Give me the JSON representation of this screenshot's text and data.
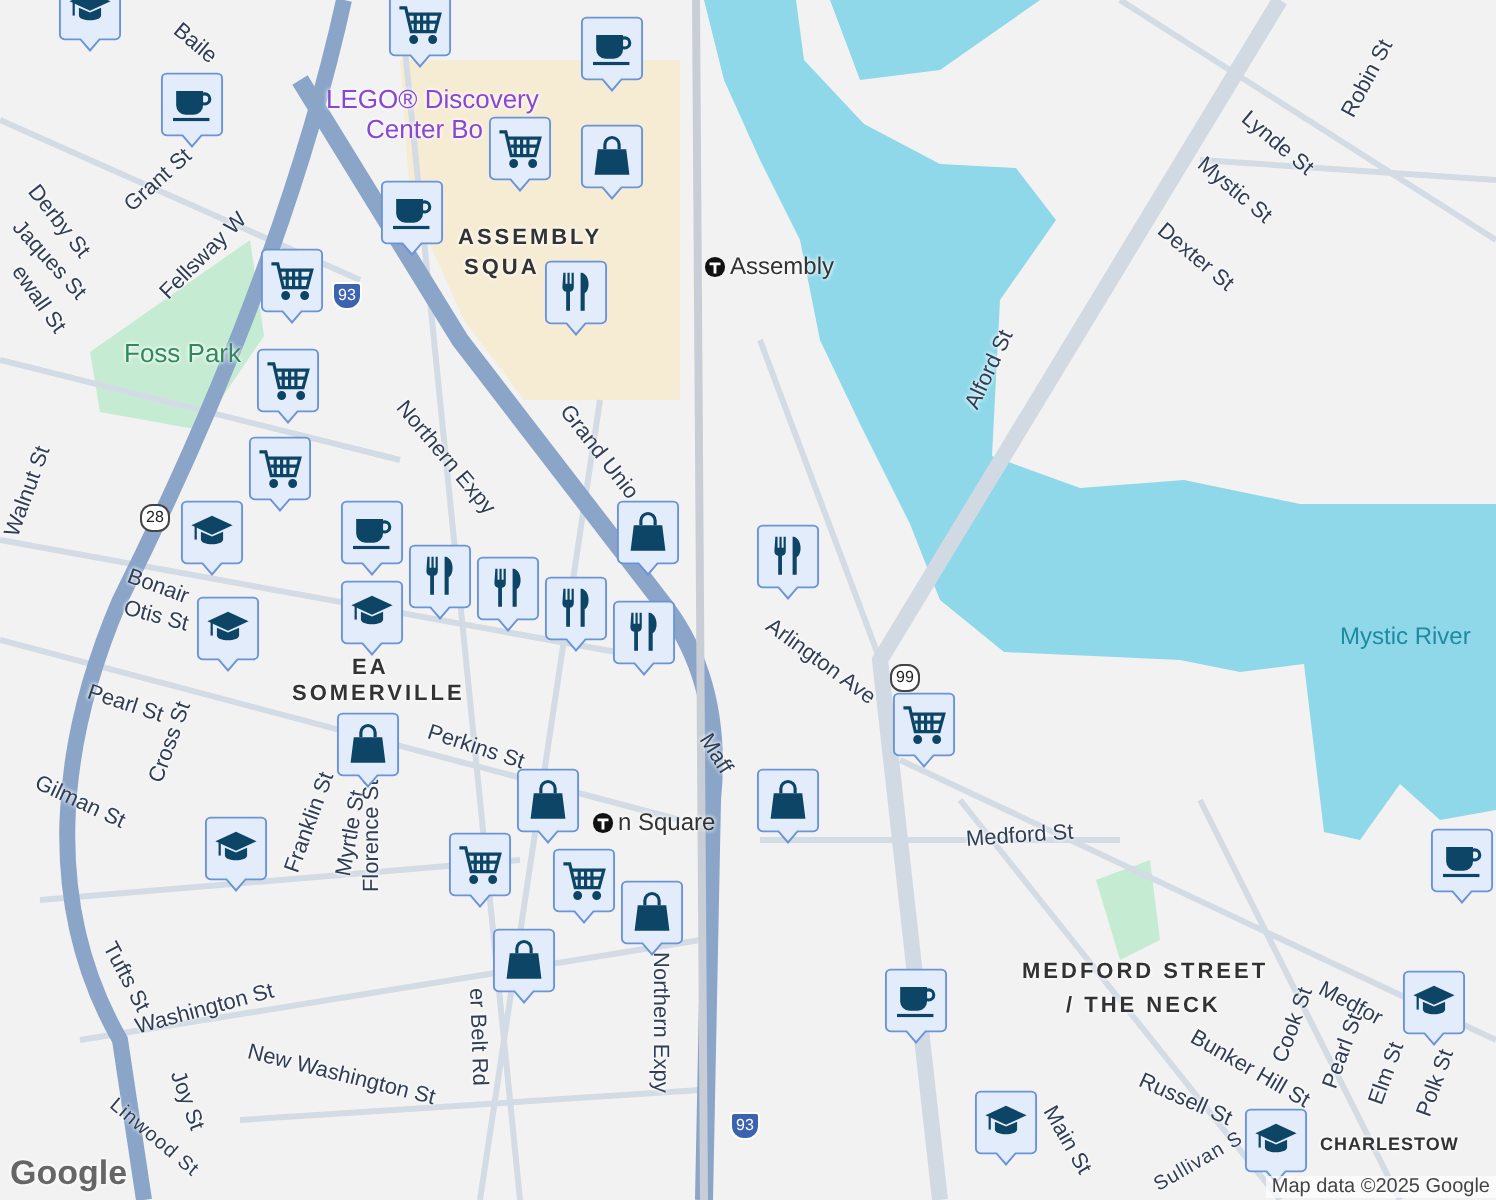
{
  "map": {
    "labels": [
      {
        "text": "Baile",
        "kind": "street"
      },
      {
        "text": "Derby St",
        "kind": "street"
      },
      {
        "text": "Grant St",
        "kind": "street"
      },
      {
        "text": "Jaques St",
        "kind": "street"
      },
      {
        "text": "ewall St",
        "kind": "street"
      },
      {
        "text": "Fellsway W",
        "kind": "street"
      },
      {
        "text": "Foss Park",
        "kind": "park"
      },
      {
        "text": "LEGO® Discovery",
        "kind": "poi"
      },
      {
        "text": "Center Bo",
        "kind": "poi"
      },
      {
        "text": "ASSEMBLY",
        "kind": "district"
      },
      {
        "text": "SQUA",
        "kind": "district"
      },
      {
        "text": "Assembly",
        "kind": "transit"
      },
      {
        "text": "Grand Unio",
        "kind": "street"
      },
      {
        "text": "Northern Expy",
        "kind": "street"
      },
      {
        "text": "Walnut St",
        "kind": "street"
      },
      {
        "text": "Bonair",
        "kind": "street"
      },
      {
        "text": "Otis St",
        "kind": "street"
      },
      {
        "text": "Pearl St",
        "kind": "street"
      },
      {
        "text": "Cross St",
        "kind": "street"
      },
      {
        "text": "Gilman St",
        "kind": "street"
      },
      {
        "text": "EA",
        "kind": "district"
      },
      {
        "text": "SOMERVILLE",
        "kind": "district"
      },
      {
        "text": "Perkins St",
        "kind": "street"
      },
      {
        "text": "Franklin St",
        "kind": "street"
      },
      {
        "text": "Myrtle St",
        "kind": "street"
      },
      {
        "text": "Florence St",
        "kind": "street"
      },
      {
        "text": "n Square",
        "kind": "transit"
      },
      {
        "text": "Tufts St",
        "kind": "street"
      },
      {
        "text": "Washington St",
        "kind": "street"
      },
      {
        "text": "New Washington St",
        "kind": "street"
      },
      {
        "text": "Joy St",
        "kind": "street"
      },
      {
        "text": "Linwood St",
        "kind": "street"
      },
      {
        "text": "er Belt Rd",
        "kind": "street"
      },
      {
        "text": "Northern Expy",
        "kind": "street"
      },
      {
        "text": "Alford St",
        "kind": "street"
      },
      {
        "text": "Lynde St",
        "kind": "street"
      },
      {
        "text": "Mystic St",
        "kind": "street"
      },
      {
        "text": "Dexter St",
        "kind": "street"
      },
      {
        "text": "Robin St",
        "kind": "street"
      },
      {
        "text": "Mystic River",
        "kind": "water"
      },
      {
        "text": "Arlington Ave",
        "kind": "street"
      },
      {
        "text": "Medford St",
        "kind": "street"
      },
      {
        "text": "MEDFORD STREET",
        "kind": "district"
      },
      {
        "text": "/ THE NECK",
        "kind": "district"
      },
      {
        "text": "Medfor",
        "kind": "street"
      },
      {
        "text": "Bunker Hill St",
        "kind": "street"
      },
      {
        "text": "Russell St",
        "kind": "street"
      },
      {
        "text": "Cook St",
        "kind": "street"
      },
      {
        "text": "Pearl St",
        "kind": "street"
      },
      {
        "text": "Elm St",
        "kind": "street"
      },
      {
        "text": "Polk St",
        "kind": "street"
      },
      {
        "text": "Main St",
        "kind": "street"
      },
      {
        "text": "CHARLESTOW",
        "kind": "district"
      },
      {
        "text": "Sullivan S",
        "kind": "street"
      },
      {
        "text": "Maff",
        "kind": "street"
      }
    ],
    "shields": [
      {
        "text": "28",
        "kind": "state"
      },
      {
        "text": "99",
        "kind": "state"
      },
      {
        "text": "93",
        "kind": "interstate"
      },
      {
        "text": "93",
        "kind": "interstate"
      }
    ],
    "pins": [
      {
        "kind": "school"
      },
      {
        "kind": "cart"
      },
      {
        "kind": "cafe"
      },
      {
        "kind": "cafe"
      },
      {
        "kind": "cart"
      },
      {
        "kind": "bag"
      },
      {
        "kind": "cafe"
      },
      {
        "kind": "restaurant"
      },
      {
        "kind": "cart"
      },
      {
        "kind": "cart"
      },
      {
        "kind": "cart"
      },
      {
        "kind": "school"
      },
      {
        "kind": "bag"
      },
      {
        "kind": "cafe"
      },
      {
        "kind": "restaurant"
      },
      {
        "kind": "restaurant"
      },
      {
        "kind": "restaurant"
      },
      {
        "kind": "restaurant"
      },
      {
        "kind": "restaurant"
      },
      {
        "kind": "school"
      },
      {
        "kind": "school"
      },
      {
        "kind": "bag"
      },
      {
        "kind": "school"
      },
      {
        "kind": "bag"
      },
      {
        "kind": "cart"
      },
      {
        "kind": "cart"
      },
      {
        "kind": "bag"
      },
      {
        "kind": "bag"
      },
      {
        "kind": "bag"
      },
      {
        "kind": "cart"
      },
      {
        "kind": "cafe"
      },
      {
        "kind": "school"
      },
      {
        "kind": "school"
      },
      {
        "kind": "school"
      },
      {
        "kind": "cafe"
      }
    ],
    "logo": "Google",
    "attribution": "Map data ©2025 Google"
  }
}
